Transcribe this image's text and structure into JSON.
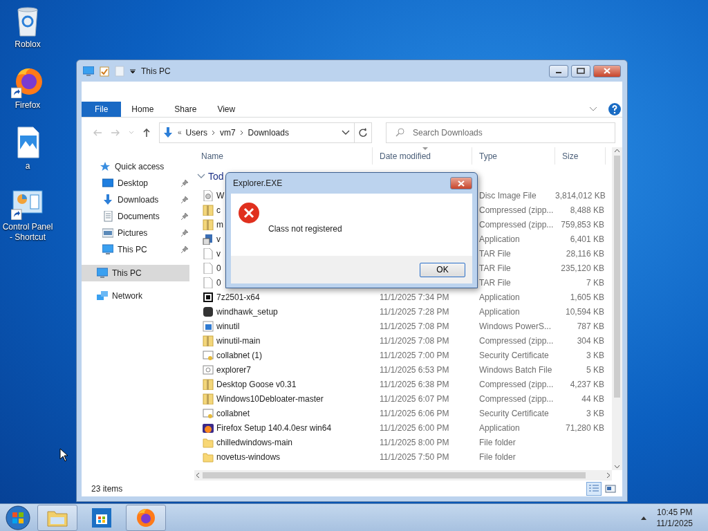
{
  "desktop_icons": [
    {
      "label": "Roblox",
      "kind": "recycle",
      "shortcut": false
    },
    {
      "label": "Firefox",
      "kind": "browser",
      "shortcut": true
    },
    {
      "label": "a",
      "kind": "image",
      "shortcut": false
    },
    {
      "label": "Control Panel - Shortcut",
      "kind": "control",
      "shortcut": true
    }
  ],
  "window": {
    "title": "This PC",
    "ribbon_tabs": [
      {
        "label": "File",
        "kind": "menu",
        "selected": false
      },
      {
        "label": "Home",
        "kind": "tab",
        "selected": false
      },
      {
        "label": "Share",
        "kind": "tab",
        "selected": false
      },
      {
        "label": "View",
        "kind": "tab",
        "selected": false
      }
    ],
    "address": {
      "crumbs": [
        "Users",
        "vm7",
        "Downloads"
      ],
      "overflow": "«"
    },
    "search": {
      "placeholder": "Search Downloads"
    },
    "nav": [
      {
        "label": "Quick access",
        "kind": "star",
        "selected": false,
        "children": [
          {
            "label": "Desktop",
            "kind": "desktop",
            "pinned": true,
            "selected": false
          },
          {
            "label": "Downloads",
            "kind": "downloads",
            "pinned": true,
            "selected": false
          },
          {
            "label": "Documents",
            "kind": "documents",
            "pinned": true,
            "selected": false
          },
          {
            "label": "Pictures",
            "kind": "pictures",
            "pinned": true,
            "selected": false
          },
          {
            "label": "This PC",
            "kind": "pc",
            "pinned": true,
            "selected": false
          }
        ]
      },
      {
        "label": "This PC",
        "kind": "pc",
        "selected": true
      },
      {
        "label": "Network",
        "kind": "network",
        "selected": false
      }
    ],
    "columns": [
      {
        "label": "Name",
        "sorted": false
      },
      {
        "label": "Date modified",
        "sorted": true
      },
      {
        "label": "Type",
        "sorted": false
      },
      {
        "label": "Size",
        "sorted": false
      }
    ],
    "group": "Tod",
    "files": [
      {
        "name": "W",
        "type": "Disc Image File",
        "size": "3,814,012 KB",
        "kind": "disc"
      },
      {
        "name": "c",
        "type": "Compressed (zipp...",
        "size": "8,488 KB",
        "kind": "zip"
      },
      {
        "name": "m",
        "type": "Compressed (zipp...",
        "size": "759,853 KB",
        "kind": "zip"
      },
      {
        "name": "v",
        "type": "Application",
        "size": "6,401 KB",
        "kind": "setup"
      },
      {
        "name": "v",
        "type": "TAR File",
        "size": "28,116 KB",
        "kind": "file"
      },
      {
        "name": "0",
        "type": "TAR File",
        "size": "235,120 KB",
        "kind": "file"
      },
      {
        "name": "0",
        "type": "TAR File",
        "size": "7 KB",
        "kind": "file"
      },
      {
        "name": "7z2501-x64",
        "date": "11/1/2025 7:34 PM",
        "type": "Application",
        "size": "1,605 KB",
        "kind": "sevenzip"
      },
      {
        "name": "windhawk_setup",
        "date": "11/1/2025 7:28 PM",
        "type": "Application",
        "size": "10,594 KB",
        "kind": "darkapp"
      },
      {
        "name": "winutil",
        "date": "11/1/2025 7:08 PM",
        "type": "Windows PowerS...",
        "size": "787 KB",
        "kind": "script"
      },
      {
        "name": "winutil-main",
        "date": "11/1/2025 7:08 PM",
        "type": "Compressed (zipp...",
        "size": "304 KB",
        "kind": "zip"
      },
      {
        "name": "collabnet (1)",
        "date": "11/1/2025 7:00 PM",
        "type": "Security Certificate",
        "size": "3 KB",
        "kind": "cert"
      },
      {
        "name": "explorer7",
        "date": "11/1/2025 6:53 PM",
        "type": "Windows Batch File",
        "size": "5 KB",
        "kind": "batch"
      },
      {
        "name": "Desktop Goose v0.31",
        "date": "11/1/2025 6:38 PM",
        "type": "Compressed (zipp...",
        "size": "4,237 KB",
        "kind": "zip"
      },
      {
        "name": "Windows10Debloater-master",
        "date": "11/1/2025 6:07 PM",
        "type": "Compressed (zipp...",
        "size": "44 KB",
        "kind": "zip"
      },
      {
        "name": "collabnet",
        "date": "11/1/2025 6:06 PM",
        "type": "Security Certificate",
        "size": "3 KB",
        "kind": "cert"
      },
      {
        "name": "Firefox Setup 140.4.0esr win64",
        "date": "11/1/2025 6:00 PM",
        "type": "Application",
        "size": "71,280 KB",
        "kind": "browser"
      },
      {
        "name": "chilledwindows-main",
        "date": "11/1/2025 8:00 PM",
        "type": "File folder",
        "kind": "folder"
      },
      {
        "name": "novetus-windows",
        "date": "11/1/2025 7:50 PM",
        "type": "File folder",
        "kind": "folder"
      }
    ],
    "status": "23 items",
    "views": [
      {
        "kind": "details",
        "selected": true
      },
      {
        "kind": "tiles",
        "selected": false
      }
    ]
  },
  "dialog": {
    "title": "Explorer.EXE",
    "message": "Class not registered",
    "button": "OK"
  },
  "taskbar": {
    "apps": [
      {
        "kind": "explorer",
        "active": true,
        "running": true
      },
      {
        "kind": "store",
        "active": false,
        "running": false
      },
      {
        "kind": "browser",
        "active": false,
        "running": true
      }
    ],
    "time": "10:45 PM",
    "date": "11/1/2025"
  }
}
